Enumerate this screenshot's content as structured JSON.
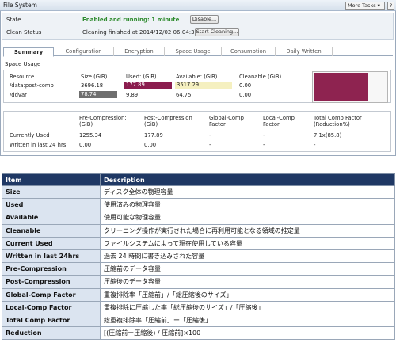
{
  "panel": {
    "title": "File System",
    "more_tasks": "More Tasks ▾",
    "help": "?"
  },
  "status": {
    "state_label": "State",
    "state_value": "Enabled and running: 1 minute",
    "disable_button": "Disable...",
    "clean_label": "Clean Status",
    "clean_value": "Cleaning finished at 2014/12/02 06:04:38",
    "start_cleaning_button": "Start Cleaning..."
  },
  "tabs": [
    "Summary",
    "Configuration",
    "Encryption",
    "Space Usage",
    "Consumption",
    "Daily Written"
  ],
  "active_tab": "Summary",
  "space_usage": {
    "title": "Space Usage",
    "headers": [
      "Resource",
      "Size (GiB)",
      "Used: (GiB)",
      "Available: (GiB)",
      "Cleanable (GiB)"
    ],
    "rows": [
      {
        "resource": "/data:post-comp",
        "size": "3696.18",
        "used": "177.89",
        "available": "3517.29",
        "cleanable": "0.00"
      },
      {
        "resource": "/ddvar",
        "size": "78.74",
        "used": "9.89",
        "available": "64.75",
        "cleanable": "0.00"
      }
    ],
    "gauge_used_fraction": 0.76
  },
  "compression": {
    "headers": [
      "Pre-Compression: (GiB)",
      "Post-Compression (GiB)",
      "Global-Comp Factor",
      "Local-Comp Factor",
      "Total Comp Factor (Reduction%)"
    ],
    "rows": [
      {
        "label": "Currently Used",
        "pre": "1255.34",
        "post": "177.89",
        "global": "-",
        "local": "-",
        "total": "7.1x(85.8)"
      },
      {
        "label": "Written in last 24 hrs",
        "pre": "0.00",
        "post": "0.00",
        "global": "-",
        "local": "-",
        "total": "-"
      }
    ]
  },
  "glossary": {
    "headers": [
      "Item",
      "Description"
    ],
    "rows": [
      {
        "item": "Size",
        "desc": "ディスク全体の物理容量"
      },
      {
        "item": "Used",
        "desc": "使用済みの物理容量"
      },
      {
        "item": "Available",
        "desc": "使用可能な物理容量"
      },
      {
        "item": "Cleanable",
        "desc": "クリーニング操作が実行された場合に再利用可能となる領域の推定量"
      },
      {
        "item": "Current Used",
        "desc": "ファイルシステムによって現在使用している容量"
      },
      {
        "item": "Written in last 24hrs",
        "desc": "過去 24 時間に書き込みされた容量"
      },
      {
        "item": "Pre-Compression",
        "desc": "圧縮前のデータ容量"
      },
      {
        "item": "Post-Compression",
        "desc": "圧縮後のデータ容量"
      },
      {
        "item": "Global-Comp Factor",
        "desc": "重複排除率「圧縮前」/「総圧縮後のサイズ」"
      },
      {
        "item": "Local-Comp Factor",
        "desc": "重複排除に圧縮した率「総圧縮後のサイズ」/「圧縮後」"
      },
      {
        "item": "Total Comp Factor",
        "desc": "総重複排除率「圧縮前」ー「圧縮後」"
      },
      {
        "item": "Reduction",
        "desc": "[(圧縮前ー圧縮後) / 圧縮前]×100"
      }
    ]
  },
  "colors": {
    "header_bg": "#1f3864",
    "item_bg": "#dbe4f0",
    "used_bar": "#8b1c4e",
    "available_bar": "#f5f0c0",
    "status_green": "#2e8b2e"
  }
}
